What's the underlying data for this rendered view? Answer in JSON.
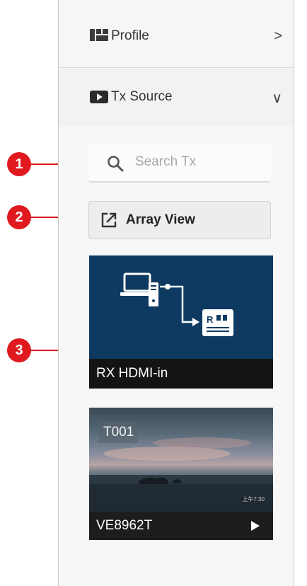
{
  "menu": {
    "profile": {
      "label": "Profile",
      "arrow": ">"
    },
    "tx_source": {
      "label": "Tx Source",
      "arrow": "∨"
    }
  },
  "search": {
    "placeholder": "Search Tx"
  },
  "array_view": {
    "label": "Array View"
  },
  "sources": [
    {
      "title": "RX HDMI-in",
      "icon": "rx-hdmi-illustration"
    },
    {
      "title": "VE8962T",
      "tag": "T001",
      "timestamp": "上午7:30",
      "thumbnail": "sunset-seascape"
    }
  ],
  "callouts": [
    "1",
    "2",
    "3"
  ],
  "colors": {
    "callout": "#e0191f",
    "card_blue": "#0e3a62",
    "footer": "#141414"
  }
}
